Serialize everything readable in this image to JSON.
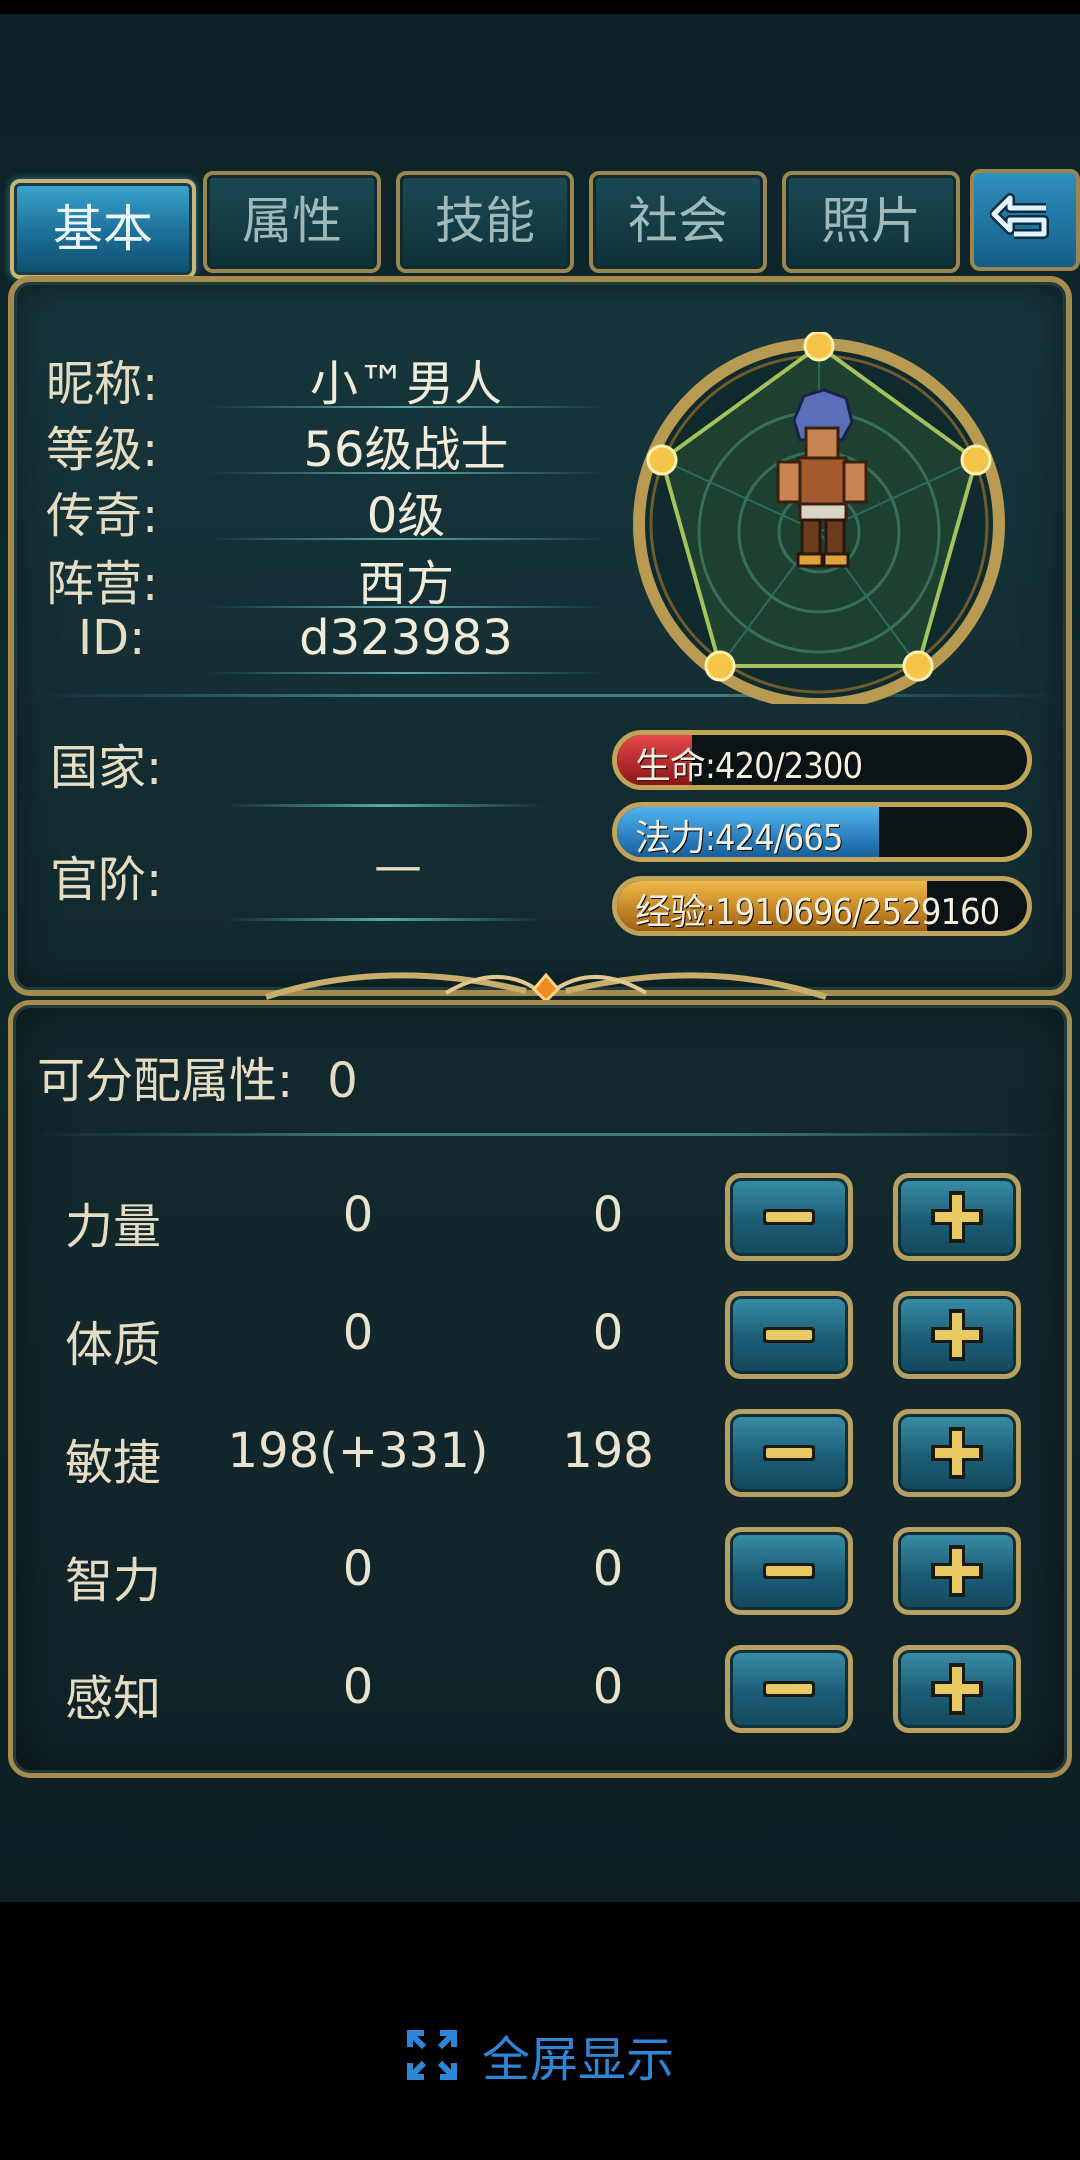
{
  "tabs": [
    {
      "label": "基本",
      "active": true
    },
    {
      "label": "属性",
      "active": false
    },
    {
      "label": "技能",
      "active": false
    },
    {
      "label": "社会",
      "active": false
    },
    {
      "label": "照片",
      "active": false
    }
  ],
  "back_icon": "return-arrow-icon",
  "profile": {
    "nickname_label": "昵称:",
    "nickname": "小™男人",
    "level_label": "等级:",
    "level": "56级战士",
    "legend_label": "传奇:",
    "legend": "0级",
    "faction_label": "阵营:",
    "faction": "西方",
    "id_label": "ID:",
    "id": "d323983",
    "country_label": "国家:",
    "country": "",
    "rank_label": "官阶:",
    "rank": "—"
  },
  "stats": {
    "hp_text": "生命:420/2300",
    "hp_fraction": 0.183,
    "mp_text": "法力:424/665",
    "mp_fraction": 0.638,
    "exp_text": "经验:1910696/2529160",
    "exp_fraction": 0.755
  },
  "attributes": {
    "free_label": "可分配属性:",
    "free_points": "0",
    "rows": [
      {
        "name": "力量",
        "value": "0",
        "base": "0"
      },
      {
        "name": "体质",
        "value": "0",
        "base": "0"
      },
      {
        "name": "敏捷",
        "value": "198(+331)",
        "base": "198"
      },
      {
        "name": "智力",
        "value": "0",
        "base": "0"
      },
      {
        "name": "感知",
        "value": "0",
        "base": "0"
      }
    ]
  },
  "fullscreen": {
    "label": "全屏显示",
    "icon": "expand-icon"
  },
  "colors": {
    "gold": "#a68b4f",
    "tab_active": "#2a8cbc",
    "hp": "#c0282a",
    "mp": "#2a8fd0",
    "exp": "#d99a2a",
    "link": "#2e86d6"
  }
}
